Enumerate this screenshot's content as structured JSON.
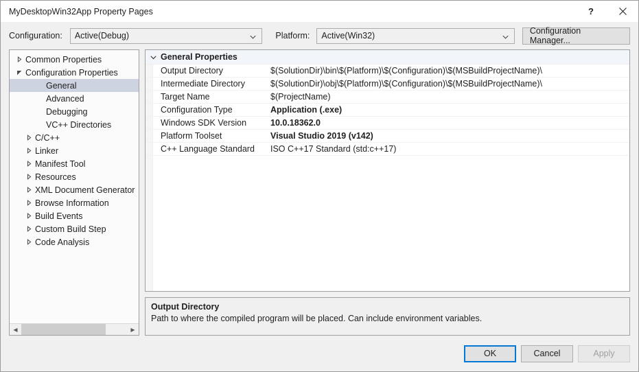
{
  "window": {
    "title": "MyDesktopWin32App Property Pages",
    "help_icon": "question-mark-icon",
    "close_icon": "close-icon"
  },
  "configbar": {
    "configuration_label": "Configuration:",
    "configuration_value": "Active(Debug)",
    "platform_label": "Platform:",
    "platform_value": "Active(Win32)",
    "configuration_manager_label": "Configuration Manager...",
    "caret_icon": "chevron-down-icon"
  },
  "tree": {
    "items": [
      {
        "label": "Common Properties",
        "indent": 0,
        "state": "collapsed",
        "selected": false
      },
      {
        "label": "Configuration Properties",
        "indent": 0,
        "state": "expanded",
        "selected": false
      },
      {
        "label": "General",
        "indent": 1,
        "state": "leaf",
        "selected": true
      },
      {
        "label": "Advanced",
        "indent": 1,
        "state": "leaf",
        "selected": false
      },
      {
        "label": "Debugging",
        "indent": 1,
        "state": "leaf",
        "selected": false
      },
      {
        "label": "VC++ Directories",
        "indent": 1,
        "state": "leaf",
        "selected": false
      },
      {
        "label": "C/C++",
        "indent": 1,
        "state": "collapsed",
        "selected": false
      },
      {
        "label": "Linker",
        "indent": 1,
        "state": "collapsed",
        "selected": false
      },
      {
        "label": "Manifest Tool",
        "indent": 1,
        "state": "collapsed",
        "selected": false
      },
      {
        "label": "Resources",
        "indent": 1,
        "state": "collapsed",
        "selected": false
      },
      {
        "label": "XML Document Generator",
        "indent": 1,
        "state": "collapsed",
        "selected": false
      },
      {
        "label": "Browse Information",
        "indent": 1,
        "state": "collapsed",
        "selected": false
      },
      {
        "label": "Build Events",
        "indent": 1,
        "state": "collapsed",
        "selected": false
      },
      {
        "label": "Custom Build Step",
        "indent": 1,
        "state": "collapsed",
        "selected": false
      },
      {
        "label": "Code Analysis",
        "indent": 1,
        "state": "collapsed",
        "selected": false
      }
    ],
    "scrollbar": {
      "left_arrow_icon": "chevron-left-icon",
      "right_arrow_icon": "chevron-right-icon"
    }
  },
  "grid": {
    "section_header": "General Properties",
    "section_chevron_icon": "chevron-down-icon",
    "rows": [
      {
        "name": "Output Directory",
        "value": "$(SolutionDir)\\bin\\$(Platform)\\$(Configuration)\\$(MSBuildProjectName)\\",
        "bold": false
      },
      {
        "name": "Intermediate Directory",
        "value": "$(SolutionDir)\\obj\\$(Platform)\\$(Configuration)\\$(MSBuildProjectName)\\",
        "bold": false
      },
      {
        "name": "Target Name",
        "value": "$(ProjectName)",
        "bold": false
      },
      {
        "name": "Configuration Type",
        "value": "Application (.exe)",
        "bold": true
      },
      {
        "name": "Windows SDK Version",
        "value": "10.0.18362.0",
        "bold": true
      },
      {
        "name": "Platform Toolset",
        "value": "Visual Studio 2019 (v142)",
        "bold": true
      },
      {
        "name": "C++ Language Standard",
        "value": "ISO C++17 Standard (std:c++17)",
        "bold": false
      }
    ]
  },
  "description": {
    "title": "Output Directory",
    "text": "Path to where the compiled program will be placed. Can include environment variables."
  },
  "footer": {
    "ok_label": "OK",
    "cancel_label": "Cancel",
    "apply_label": "Apply",
    "apply_disabled": true
  },
  "colors": {
    "dialog_bg": "#f0f0f0",
    "titlebar_bg": "#ffffff",
    "pane_bg": "#ffffff",
    "selection": "#cdd3e0",
    "focus_accent": "#0078d7",
    "section_header_bg": "#f2f5fa",
    "disabled_text": "#a0a0a0"
  }
}
